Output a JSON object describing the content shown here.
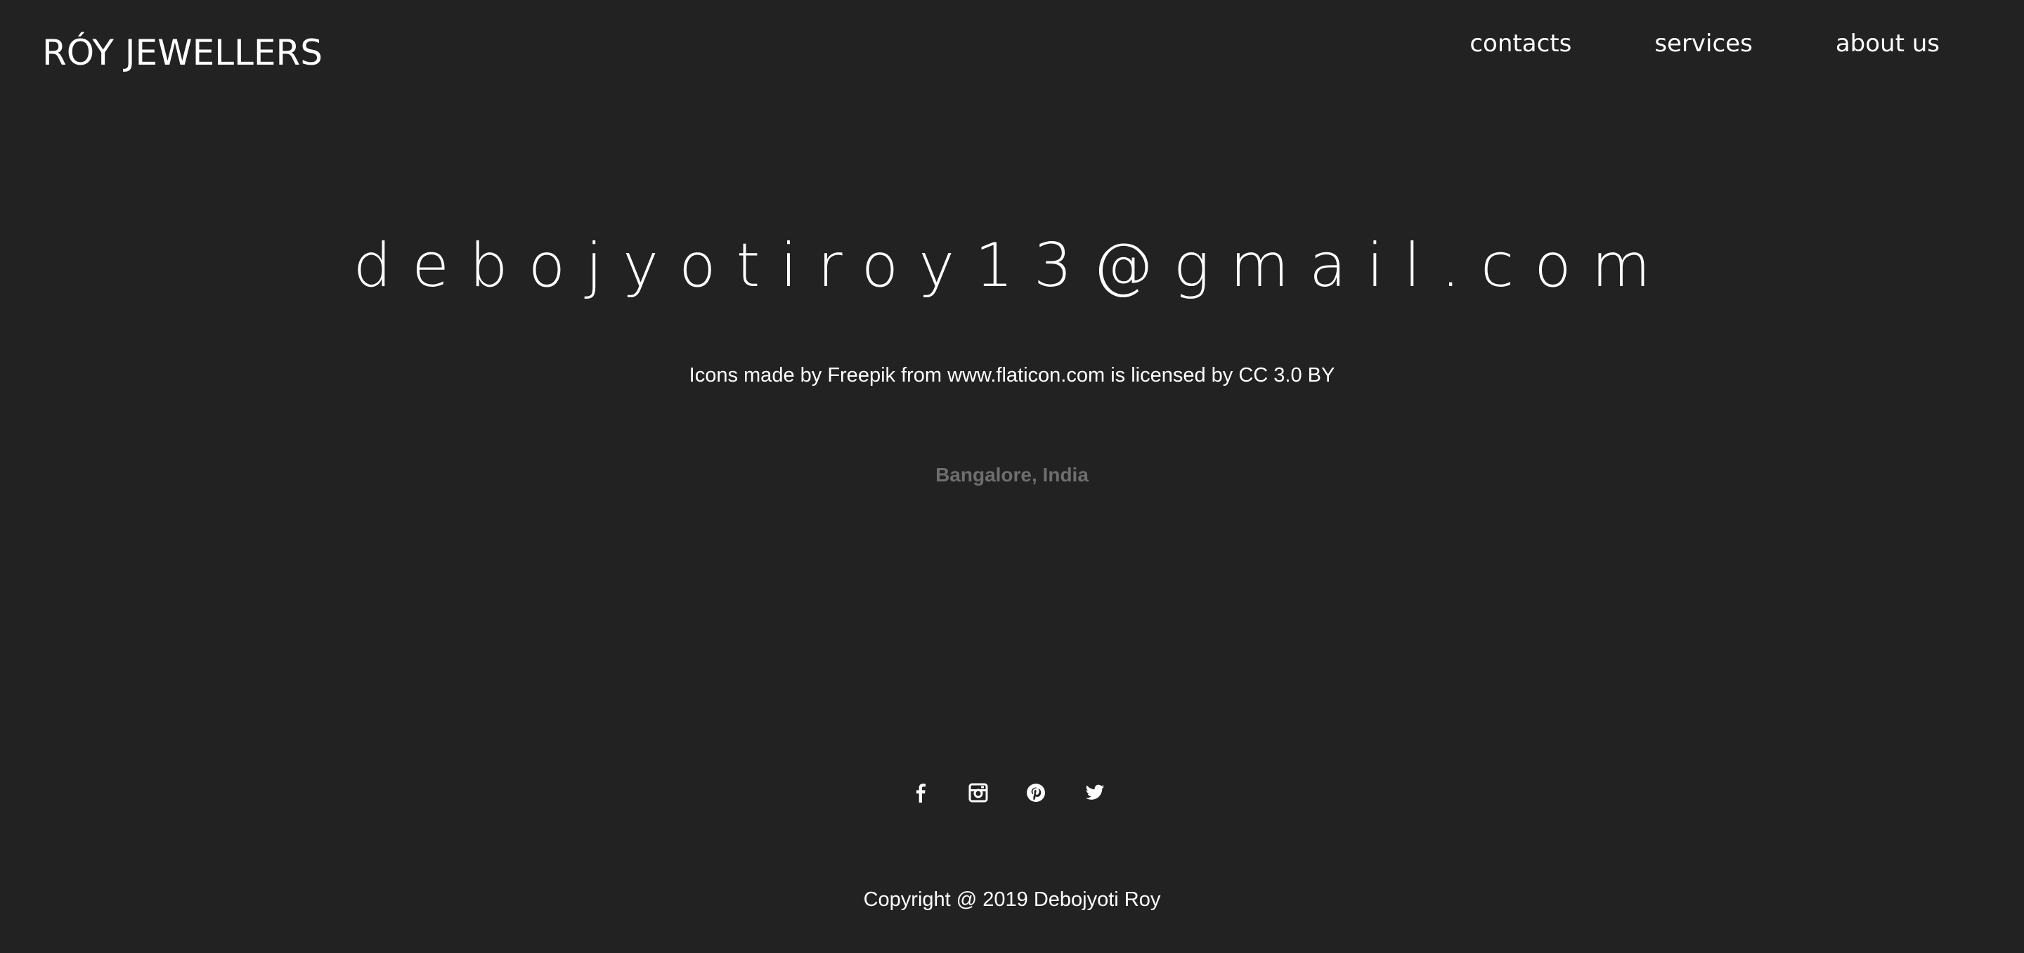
{
  "header": {
    "brand": "RÓY JEWELLERS",
    "nav": [
      {
        "label": "contacts"
      },
      {
        "label": "services"
      },
      {
        "label": "about us"
      }
    ]
  },
  "main": {
    "email": "debojyotiroy13@gmail.com",
    "credit": "Icons made by Freepik from www.flaticon.com is licensed by CC 3.0 BY",
    "location": "Bangalore, India"
  },
  "footer": {
    "socials": [
      {
        "icon": "facebook-icon"
      },
      {
        "icon": "instagram-icon"
      },
      {
        "icon": "pinterest-icon"
      },
      {
        "icon": "twitter-icon"
      }
    ],
    "copyright": "Copyright @ 2019 Debojyoti Roy"
  },
  "colors": {
    "background": "#222222",
    "text": "#ffffff",
    "muted": "#6e6e6e"
  }
}
